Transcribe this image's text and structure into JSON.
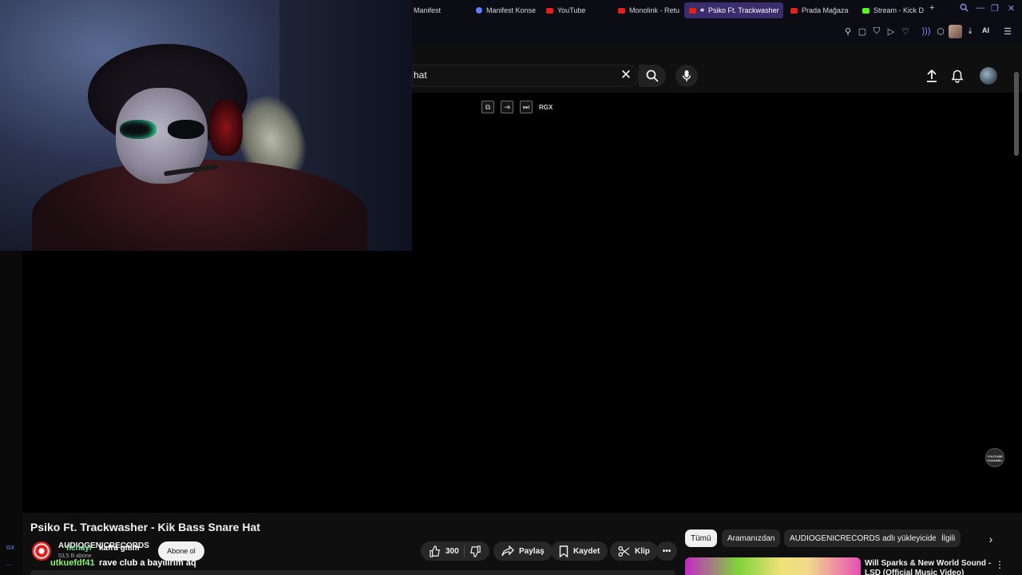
{
  "browser": {
    "tabs": [
      {
        "label": "Manifest",
        "favicon": "none",
        "active": false
      },
      {
        "label": "Manifest Konse",
        "favicon": "globe-icon",
        "active": false
      },
      {
        "label": "YouTube",
        "favicon": "youtube-icon",
        "active": false
      },
      {
        "label": "Monolink - Retu",
        "favicon": "youtube-icon",
        "active": false
      },
      {
        "label": "Psiko Ft. Trackwasher",
        "favicon": "youtube-icon",
        "active": true
      },
      {
        "label": "Prada Mağaza",
        "favicon": "youtube-icon",
        "active": false
      },
      {
        "label": "Stream - Kick D",
        "favicon": "kick-icon",
        "active": false
      }
    ],
    "new_tab_label": "+",
    "ai_label": "AI",
    "accent_color": "#3a2d6e"
  },
  "youtube": {
    "search": {
      "value": "hat"
    },
    "player_controls": {
      "speed_label": "RGX"
    },
    "watermark": {
      "line1": "YOUTUBE",
      "line2": "CHANNEL"
    }
  },
  "video": {
    "title": "Psiko Ft. Trackwasher - Kik Bass Snare Hat",
    "channel_name": "AUDIOGENICRECORDS",
    "subscribers": "53,5 B abone",
    "subscribe_label": "Abone ol",
    "likes": "300",
    "share_label": "Paylaş",
    "save_label": "Kaydet",
    "clip_label": "Klip"
  },
  "chat_overlay": [
    {
      "user": "ficnayr",
      "message": "kafra gitim"
    },
    {
      "user": "utkuefdf41",
      "message": "rave club a bayılırım aq"
    }
  ],
  "chat_side": {
    "badge": "GX",
    "more": "..."
  },
  "recommendations": {
    "chips": [
      "Tümü",
      "Aramanızdan",
      "AUDIOGENICRECORDS adlı yükleyiciden",
      "İlgili"
    ],
    "selected_chip": "Tümü",
    "first_item_title": "Will Sparks & New World Sound - LSD (Official Music Video)"
  }
}
